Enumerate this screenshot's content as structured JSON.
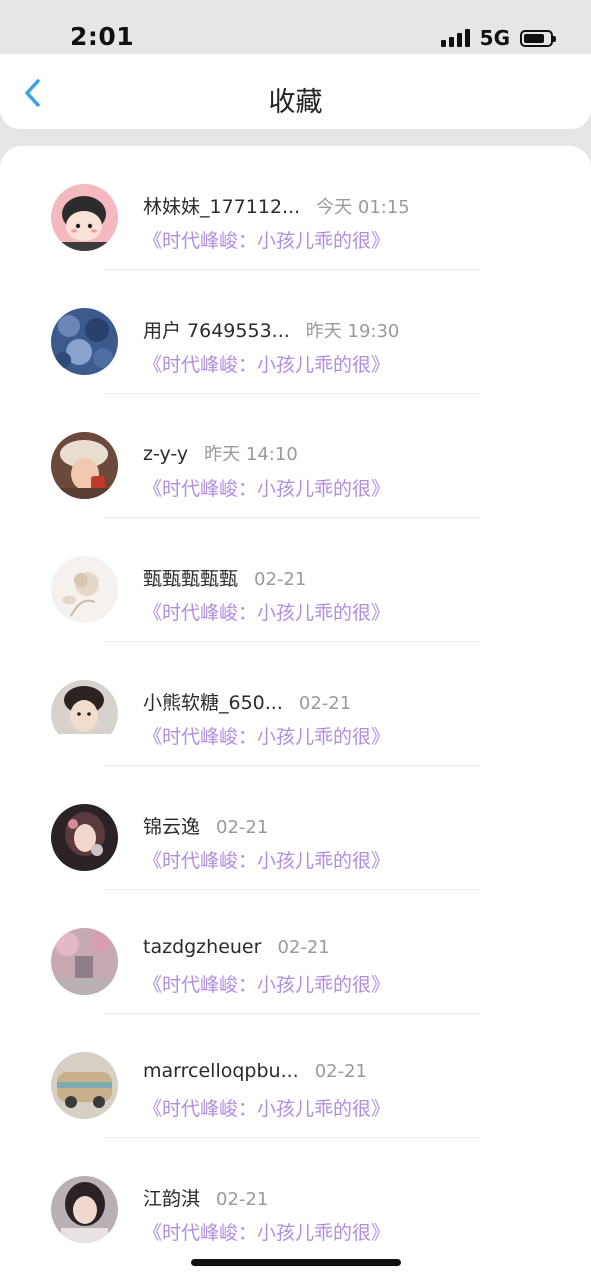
{
  "status_bar": {
    "time": "2:01",
    "network": "5G"
  },
  "header": {
    "title": "收藏",
    "back_icon": "chevron-left-icon",
    "accent_color": "#3aa0e8"
  },
  "items": [
    {
      "name": "林妹妹_177112...",
      "time": "今天 01:15",
      "drama": "《时代峰峻：小孩儿乖的很》"
    },
    {
      "name": "用户 7649553...",
      "time": "昨天 19:30",
      "drama": "《时代峰峻：小孩儿乖的很》"
    },
    {
      "name": "z-y-y",
      "time": "昨天 14:10",
      "drama": "《时代峰峻：小孩儿乖的很》"
    },
    {
      "name": "甄甄甄甄甄",
      "time": "02-21",
      "drama": "《时代峰峻：小孩儿乖的很》"
    },
    {
      "name": "小熊软糖_650...",
      "time": "02-21",
      "drama": "《时代峰峻：小孩儿乖的很》"
    },
    {
      "name": "锦云逸",
      "time": "02-21",
      "drama": "《时代峰峻：小孩儿乖的很》"
    },
    {
      "name": "tazdgzheuer",
      "time": "02-21",
      "drama": "《时代峰峻：小孩儿乖的很》"
    },
    {
      "name": "marrcelloqpbu...",
      "time": "02-21",
      "drama": "《时代峰峻：小孩儿乖的很》"
    },
    {
      "name": "江韵淇",
      "time": "02-21",
      "drama": "《时代峰峻：小孩儿乖的很》"
    }
  ],
  "colors": {
    "name_text": "#2b2b2b",
    "time_text": "#9a9a9a",
    "drama_text": "#b08ee0"
  }
}
